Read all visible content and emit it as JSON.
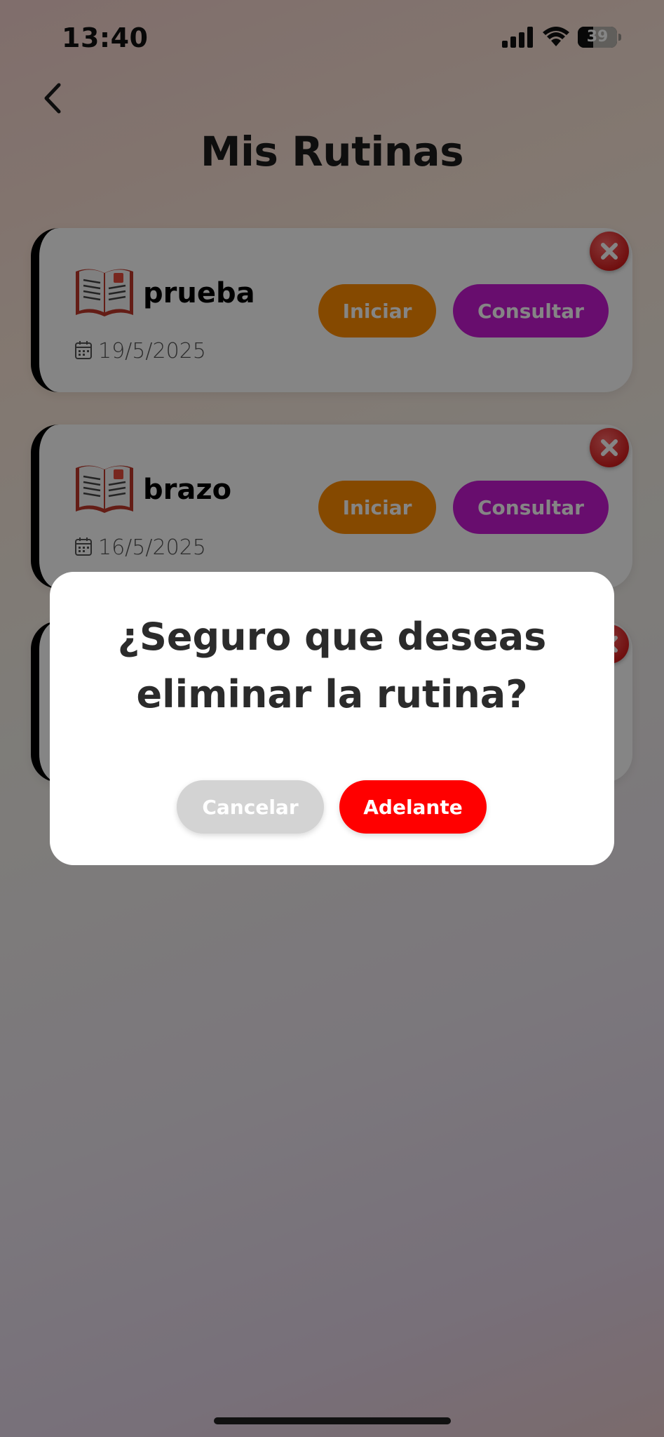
{
  "status_bar": {
    "time": "13:40",
    "battery": "39",
    "battery_level": 0.39
  },
  "header": {
    "title": "Mis Rutinas"
  },
  "routines": [
    {
      "name": "prueba",
      "date": "19/5/2025"
    },
    {
      "name": "brazo",
      "date": "16/5/2025"
    }
  ],
  "buttons": {
    "start": "Iniciar",
    "view": "Consultar"
  },
  "dialog": {
    "title": "¿Seguro que deseas eliminar la rutina?",
    "cancel": "Cancelar",
    "confirm": "Adelante"
  },
  "colors": {
    "start_button": "#ff8c00",
    "view_button": "#c81ad4",
    "confirm_button": "#ff0000",
    "cancel_button": "#d3d3d3",
    "delete_icon": "#d81f1f"
  }
}
